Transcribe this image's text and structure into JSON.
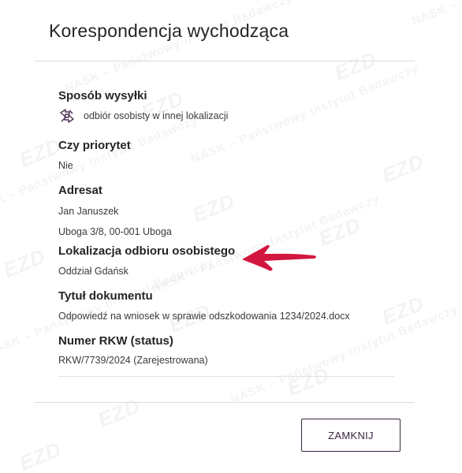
{
  "dialog": {
    "title": "Korespondencja wychodząca",
    "close_label": "ZAMKNIJ"
  },
  "fields": {
    "delivery_method": {
      "label": "Sposób wysyłki",
      "value": "odbiór osobisty w innej lokalizacji",
      "icon": "personal-pickup-icon"
    },
    "priority": {
      "label": "Czy priorytet",
      "value": "Nie"
    },
    "addressee": {
      "label": "Adresat",
      "name": "Jan Januszek",
      "address": "Uboga 3/8, 00-001 Uboga"
    },
    "pickup_location": {
      "label": "Lokalizacja odbioru osobistego",
      "value": "Oddział Gdańsk"
    },
    "document_title": {
      "label": "Tytuł dokumentu",
      "value": "Odpowiedź na wniosek w sprawie odszkodowania 1234/2024.docx"
    },
    "rkw_number": {
      "label": "Numer RKW (status)",
      "value": "RKW/7739/2024 (Zarejestrowana)"
    }
  },
  "annotation": {
    "arrow_color": "#d1173f"
  },
  "colors": {
    "accent": "#3b2440",
    "text": "#252525"
  }
}
